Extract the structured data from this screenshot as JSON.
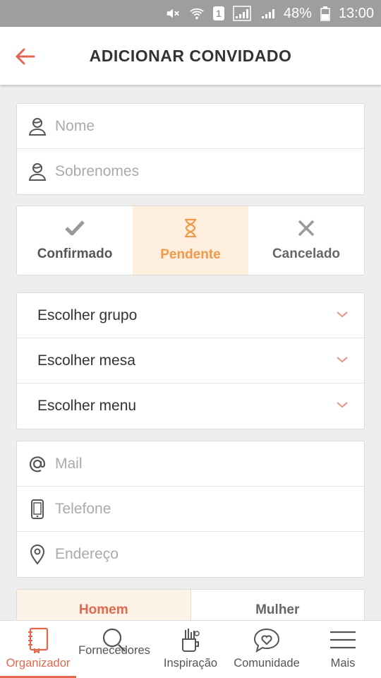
{
  "status_bar": {
    "battery": "48%",
    "time": "13:00",
    "sim": "1"
  },
  "app_bar": {
    "title": "ADICIONAR CONVIDADO"
  },
  "name_card": {
    "first_name_placeholder": "Nome",
    "last_name_placeholder": "Sobrenomes"
  },
  "rsvp": {
    "options": [
      {
        "label": "Confirmado",
        "icon": "check-icon"
      },
      {
        "label": "Pendente",
        "icon": "hourglass-icon"
      },
      {
        "label": "Cancelado",
        "icon": "close-icon"
      }
    ],
    "selected": "Pendente",
    "accent": "#ef9a4a",
    "selected_bg": "#fdeedd"
  },
  "selects": [
    {
      "label": "Escolher grupo"
    },
    {
      "label": "Escolher mesa"
    },
    {
      "label": "Escolher menu"
    }
  ],
  "contact_card": {
    "mail_placeholder": "Mail",
    "phone_placeholder": "Telefone",
    "address_placeholder": "Endereço"
  },
  "gender": {
    "male": "Homem",
    "female": "Mulher",
    "selected": "Homem"
  },
  "bottom_nav": {
    "items": [
      {
        "label": "Organizador",
        "icon": "notebook-icon"
      },
      {
        "label": "Fornecedores",
        "icon": "search-icon"
      },
      {
        "label": "Inspiração",
        "icon": "inspiration-icon"
      },
      {
        "label": "Comunidade",
        "icon": "chat-heart-icon"
      },
      {
        "label": "Mais",
        "icon": "menu-icon"
      }
    ],
    "active": "Organizador"
  },
  "colors": {
    "brand": "#e2674f",
    "muted": "#aaaaaa",
    "status_bar": "#9e9e9e"
  }
}
